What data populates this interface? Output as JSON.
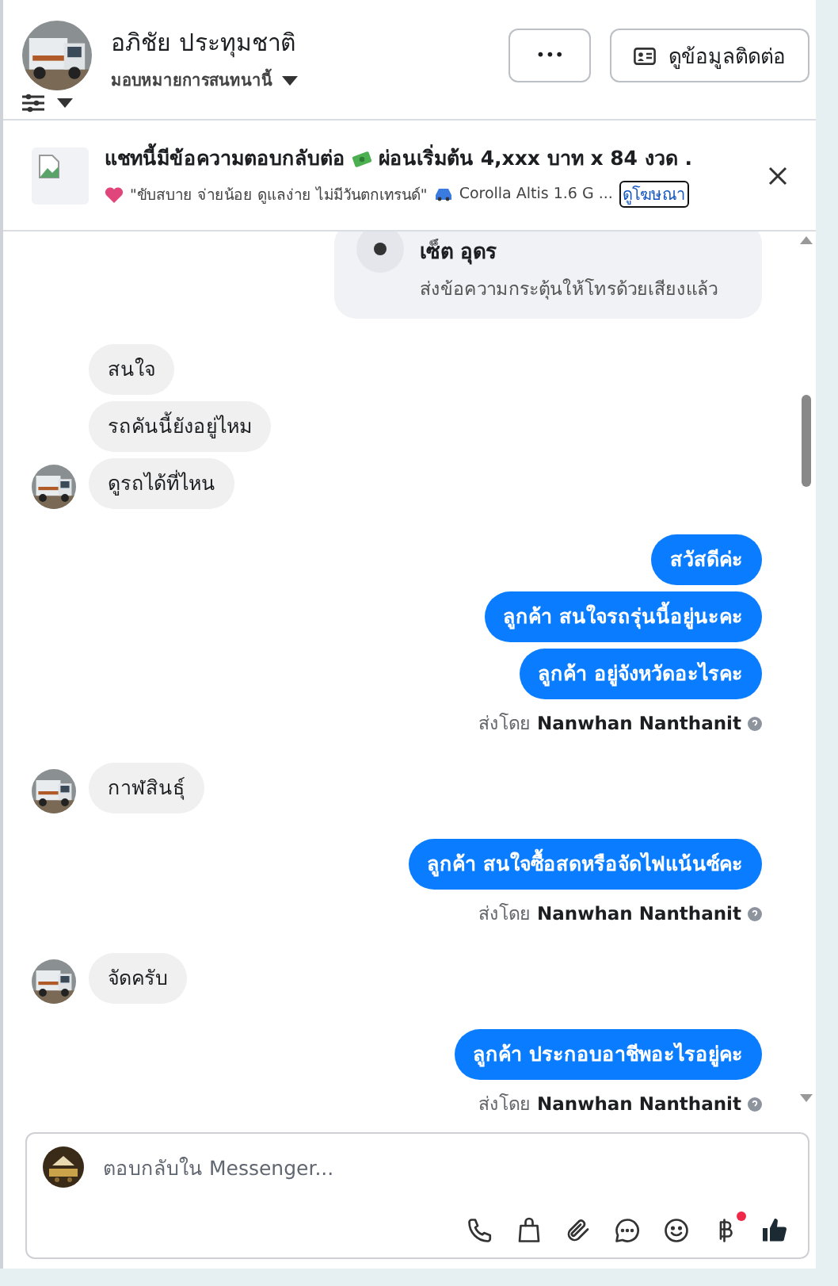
{
  "header": {
    "name": "อภิชัย ประทุมชาติ",
    "assign_label": "มอบหมายการสนทนานี้",
    "more_button": "•••",
    "contact_button": "ดูข้อมูลติดต่อ"
  },
  "banner": {
    "title_start": "แชทนี้มีข้อความตอบกลับต่อ",
    "title_end": "ผ่อนเริ่มต้น 4,xxx บาท x 84 งวด .",
    "subtitle_quote": "\"ขับสบาย จ่ายน้อย ดูแลง่าย ไม่มีวันตกเทรนด์\"",
    "subtitle_car": "Corolla Altis 1.6 G ...",
    "link": "ดูโฆษณา"
  },
  "messages": [
    {
      "kind": "call_card",
      "title": "เซ็ต อุดร",
      "text": "ส่งข้อความกระตุ้นให้โทรด้วยเสียงแล้ว"
    },
    {
      "kind": "incoming",
      "texts": [
        "สนใจ",
        "รถคันนี้ยังอยู่ไหม",
        "ดูรถได้ที่ไหน"
      ]
    },
    {
      "kind": "outgoing",
      "texts": [
        "สวัสดีค่ะ",
        "ลูกค้า สนใจรถรุ่นนี้อยู่นะคะ",
        "ลูกค้า อยู่จังหวัดอะไรคะ"
      ],
      "sent_label": "ส่งโดย",
      "sender": "Nanwhan Nanthanit"
    },
    {
      "kind": "incoming",
      "texts": [
        "กาฬสินธุ์"
      ]
    },
    {
      "kind": "outgoing",
      "texts": [
        "ลูกค้า สนใจซื้อสดหรือจัดไฟแน้นซ์คะ"
      ],
      "sent_label": "ส่งโดย",
      "sender": "Nanwhan Nanthanit"
    },
    {
      "kind": "incoming",
      "texts": [
        "จัดครับ"
      ]
    },
    {
      "kind": "outgoing",
      "texts": [
        "ลูกค้า ประกอบอาชีพอะไรอยู่คะ"
      ],
      "sent_label": "ส่งโดย",
      "sender": "Nanwhan Nanthanit"
    }
  ],
  "composer": {
    "placeholder": "ตอบกลับใน Messenger..."
  }
}
